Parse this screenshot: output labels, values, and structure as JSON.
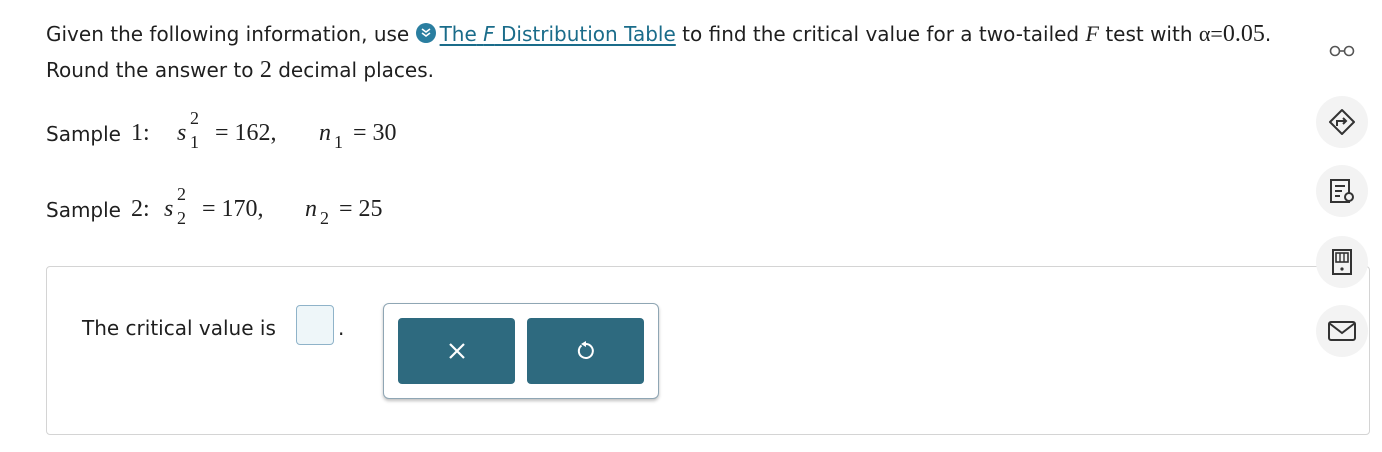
{
  "question": {
    "intro": "Given the following information, use",
    "link_prefix": "The",
    "link_italic": "F",
    "link_suffix": "Distribution Table",
    "after_link": "to find the critical value for a two-tailed",
    "f_symbol": "F",
    "test_with": "test with",
    "alpha_symbol": "α",
    "alpha_eq": "=",
    "alpha_value": "0.05",
    "period": ".",
    "round_prefix": "Round the answer to",
    "round_digits": "2",
    "round_suffix": "decimal places."
  },
  "samples": [
    {
      "label": "Sample",
      "num": "1:",
      "var": "s",
      "sup": "2",
      "sub": "1",
      "eq1": "= 162,",
      "nvar": "n",
      "nsub": "1",
      "eq2": "= 30"
    },
    {
      "label": "Sample",
      "num": "2:",
      "var": "s",
      "sup": "2",
      "sub": "2",
      "eq1": "= 170,",
      "nvar": "n",
      "nsub": "2",
      "eq2": "= 25"
    }
  ],
  "answer": {
    "prompt": "The critical value is",
    "value": "",
    "period": "."
  },
  "keypad": {
    "clear_icon": "close-icon",
    "undo_icon": "undo-icon"
  },
  "sidebar": {
    "icons": [
      "glasses-icon",
      "direction-sign-icon",
      "checklist-lightbulb-icon",
      "calculator-icon",
      "mail-icon"
    ]
  },
  "colors": {
    "link": "#1a6c8a",
    "button": "#2e6a7f",
    "input_bg": "#eef6f9"
  }
}
